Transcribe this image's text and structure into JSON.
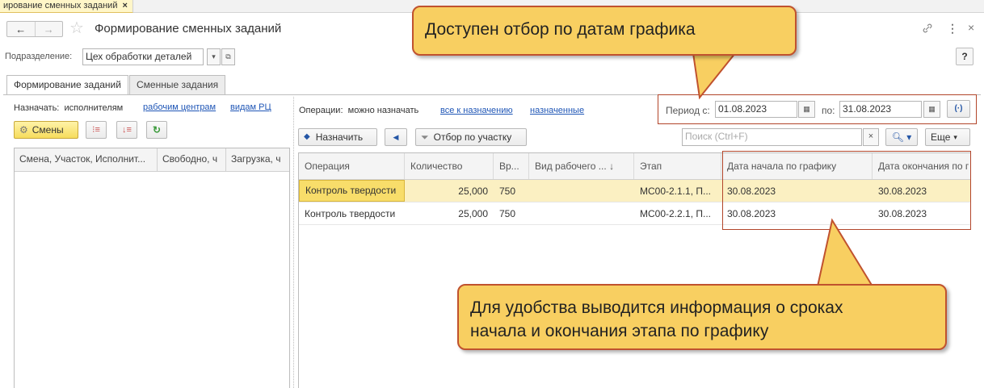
{
  "window": {
    "tab_label": "ирование сменных заданий",
    "tab_close": "×",
    "back_glyph": "←",
    "forward_glyph": "→",
    "title": "Формирование сменных заданий",
    "icons": [
      "link-icon",
      "more-icon",
      "close-icon"
    ],
    "help_label": "?"
  },
  "division": {
    "label": "Подразделение:",
    "value": "Цех обработки деталей"
  },
  "tabs": [
    {
      "label": "Формирование заданий",
      "active": true
    },
    {
      "label": "Сменные задания",
      "active": false
    }
  ],
  "left": {
    "assign_label": "Назначать:",
    "assign_current": "исполнителям",
    "assign_links": [
      "рабочим центрам",
      "видам РЦ"
    ],
    "shifts_button": "Смены",
    "columns": [
      "Смена, Участок, Исполнит...",
      "Свободно, ч",
      "Загрузка, ч"
    ]
  },
  "right": {
    "ops_label": "Операции:",
    "ops_current": "можно назначать",
    "ops_links": [
      "все к назначению",
      "назначенные"
    ],
    "period_label": "Период с:",
    "period_from": "01.08.2023",
    "period_to_label": "по:",
    "period_to": "31.08.2023",
    "assign_button": "Назначить",
    "filter_button": "Отбор по участку",
    "search_placeholder": "Поиск (Ctrl+F)",
    "more_button": "Еще",
    "columns": [
      "Операция",
      "Количество",
      "Вр...",
      "Вид рабочего ...",
      "Этап",
      "Дата начала по графику",
      "Дата окончания по г"
    ],
    "rows": [
      {
        "operation": "Контроль твердости",
        "qty": "25,000",
        "time": "750",
        "wc_type": "",
        "stage": "МС00-2.1.1, П...",
        "start": "30.08.2023",
        "end": "30.08.2023",
        "selected": true
      },
      {
        "operation": "Контроль твердости",
        "qty": "25,000",
        "time": "750",
        "wc_type": "",
        "stage": "МС00-2.2.1, П...",
        "start": "30.08.2023",
        "end": "30.08.2023",
        "selected": false
      }
    ]
  },
  "callouts": {
    "top": "Доступен отбор по датам графика",
    "bottom_line1": "Для удобства выводится информация о сроках",
    "bottom_line2": "начала и окончания этапа по графику"
  },
  "colors": {
    "callout_fill": "#f8cf61",
    "callout_border": "#c0522e",
    "selection": "#fbf0c2",
    "link": "#1f56b6"
  }
}
